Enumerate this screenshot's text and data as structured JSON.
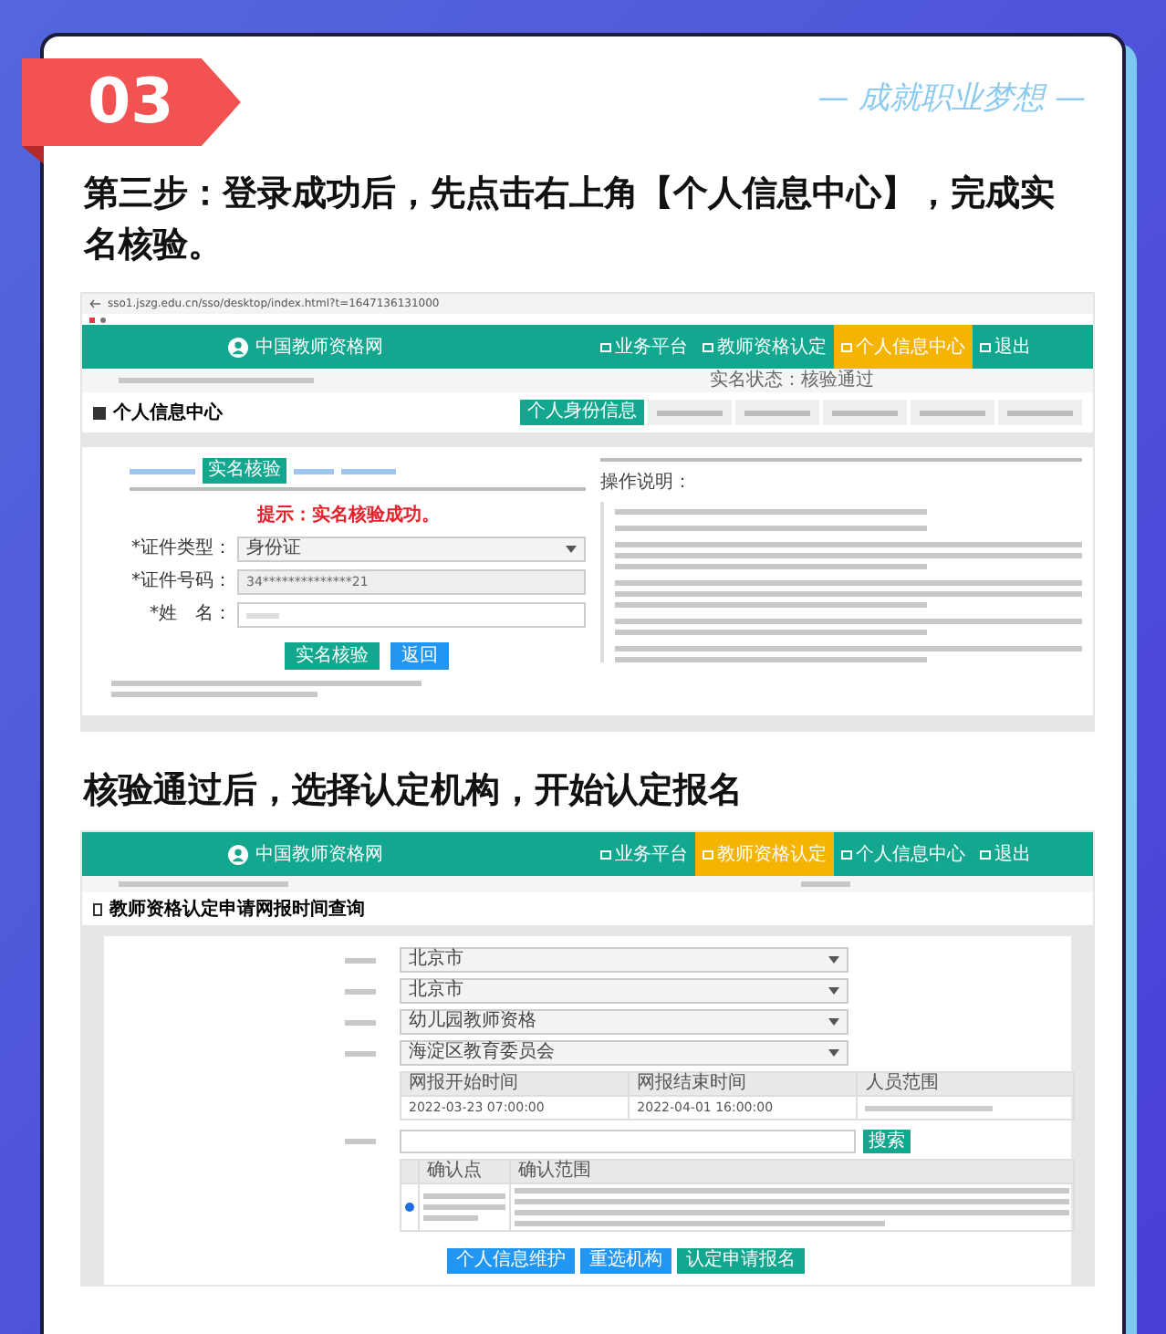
{
  "badge": {
    "number": "03"
  },
  "slogan": "— 成就职业梦想 —",
  "step_1_heading": "第三步：登录成功后，先点击右上角【个人信息中心】，完成实名核验。",
  "screenshot_1": {
    "url": "sso1.jszg.edu.cn/sso/desktop/index.html?t=1647136131000",
    "site_name": "中国教师资格网",
    "nav": [
      {
        "label": "业务平台",
        "selected": false
      },
      {
        "label": "教师资格认定",
        "selected": false
      },
      {
        "label": "个人信息中心",
        "selected": true
      },
      {
        "label": "退出",
        "selected": false
      }
    ],
    "status": "实名状态：核验通过",
    "page_title": "个人信息中心",
    "tabs": [
      {
        "label": "个人身份信息",
        "selected": true
      }
    ],
    "subtabs": [
      {
        "label": "实名核验",
        "selected": true
      }
    ],
    "notice": "提示：实名核验成功。",
    "fields": [
      {
        "label": "*证件类型：",
        "value": "身份证",
        "kind": "select"
      },
      {
        "label": "*证件号码：",
        "value": "34**************21",
        "kind": "readonly"
      },
      {
        "label": "*姓　名：",
        "kind": "text"
      }
    ],
    "buttons": [
      {
        "label": "实名核验",
        "kind": "primary"
      },
      {
        "label": "返回",
        "kind": "secondary"
      }
    ],
    "instructions_title": "操作说明："
  },
  "step_2_heading": "核验通过后，选择认定机构，开始认定报名",
  "screenshot_2": {
    "site_name": "中国教师资格网",
    "nav": [
      {
        "label": "业务平台",
        "selected": false
      },
      {
        "label": "教师资格认定",
        "selected": true
      },
      {
        "label": "个人信息中心",
        "selected": false
      },
      {
        "label": "退出",
        "selected": false
      }
    ],
    "page_title": "教师资格认定申请网报时间查询",
    "selects": [
      {
        "value": "北京市"
      },
      {
        "value": "北京市"
      },
      {
        "value": "幼儿园教师资格"
      },
      {
        "value": "海淀区教育委员会"
      }
    ],
    "time_table": {
      "columns": [
        "网报开始时间",
        "网报结束时间",
        "人员范围"
      ],
      "rows": [
        [
          "2022-03-23 07:00:00",
          "2022-04-01 16:00:00",
          ""
        ]
      ]
    },
    "search_button": "搜索",
    "confirm_table": {
      "columns": [
        "确认点",
        "确认范围"
      ],
      "rows": [
        {
          "selected": true
        }
      ]
    },
    "buttons": [
      {
        "label": "个人信息维护",
        "kind": "blue"
      },
      {
        "label": "重选机构",
        "kind": "blue"
      },
      {
        "label": "认定申请报名",
        "kind": "green"
      }
    ]
  }
}
